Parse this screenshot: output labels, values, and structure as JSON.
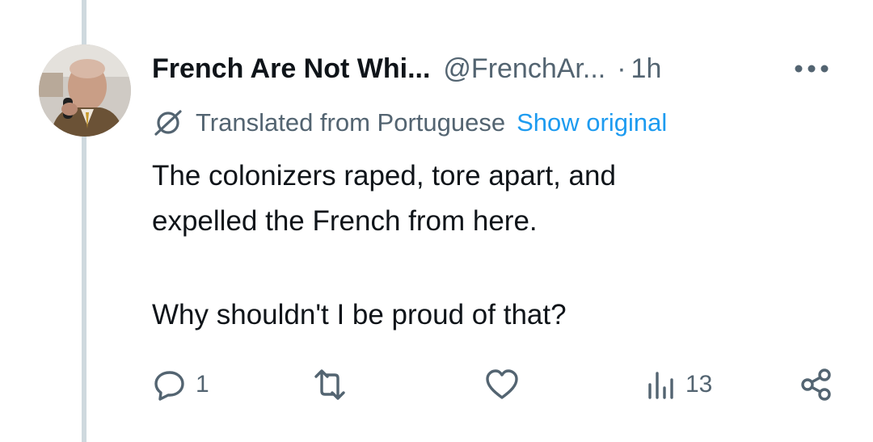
{
  "tweet": {
    "display_name": "French Are Not Whi...",
    "handle": "@FrenchAr...",
    "separator": "·",
    "time": "1h",
    "translation_note": "Translated from Portuguese",
    "show_original_label": "Show original",
    "text_lines": [
      "The colonizers raped, tore apart, and",
      "expelled the French from here.",
      "Why shouldn't I be proud of that?"
    ]
  },
  "actions": {
    "reply_count": "1",
    "retweet_count": "",
    "like_count": "",
    "views_count": "13"
  },
  "icons": {
    "more": "more-horizontal-icon",
    "translate": "globe-icon",
    "reply": "reply-icon",
    "retweet": "retweet-icon",
    "like": "heart-icon",
    "views": "views-icon",
    "share": "share-icon"
  },
  "colors": {
    "text_primary": "#0f1419",
    "text_secondary": "#536471",
    "link": "#1d9bf0",
    "thread_line": "#cfd9de"
  }
}
